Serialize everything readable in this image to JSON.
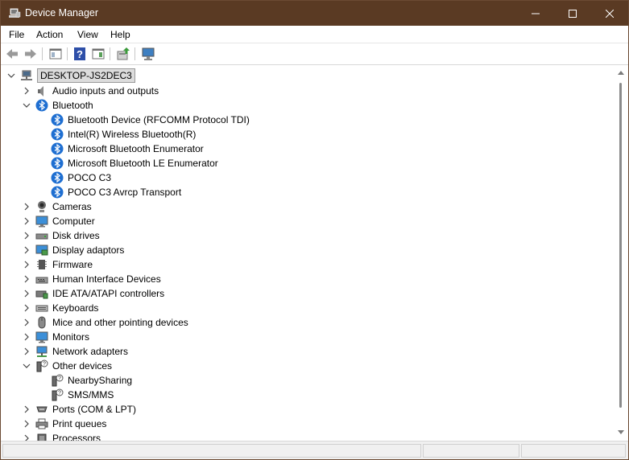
{
  "window": {
    "title": "Device Manager",
    "icons": {
      "app": "device-manager-icon",
      "minimize": "minimize-icon",
      "maximize": "maximize-icon",
      "close": "close-icon"
    },
    "colors": {
      "titlebar": "#5a3a23",
      "border": "#6b4a33",
      "root_highlight": "#dcdcdc"
    }
  },
  "menu": {
    "file": "File",
    "action": "Action",
    "view": "View",
    "help": "Help"
  },
  "toolbar": {
    "buttons": [
      {
        "name": "back-button",
        "icon": "back-arrow-icon"
      },
      {
        "name": "forward-button",
        "icon": "forward-arrow-icon"
      },
      {
        "name": "show-hide-console-tree-button",
        "icon": "console-tree-icon"
      },
      {
        "name": "help-button",
        "icon": "help-icon"
      },
      {
        "name": "action-pane-button",
        "icon": "action-pane-icon"
      },
      {
        "name": "update-driver-button",
        "icon": "update-driver-icon"
      },
      {
        "name": "scan-hardware-button",
        "icon": "scan-monitor-icon"
      }
    ]
  },
  "tree": {
    "root": {
      "label": "DESKTOP-JS2DEC3",
      "icon": "computer-network-icon",
      "expanded": true,
      "selected": true
    },
    "categories": [
      {
        "label": "Audio inputs and outputs",
        "icon": "speaker-icon",
        "expanded": false
      },
      {
        "label": "Bluetooth",
        "icon": "bluetooth-icon",
        "expanded": true,
        "children": [
          {
            "label": "Bluetooth Device (RFCOMM Protocol TDI)",
            "icon": "bluetooth-icon"
          },
          {
            "label": "Intel(R) Wireless Bluetooth(R)",
            "icon": "bluetooth-icon"
          },
          {
            "label": "Microsoft Bluetooth Enumerator",
            "icon": "bluetooth-icon"
          },
          {
            "label": "Microsoft Bluetooth LE Enumerator",
            "icon": "bluetooth-icon"
          },
          {
            "label": "POCO C3",
            "icon": "bluetooth-icon"
          },
          {
            "label": "POCO C3 Avrcp Transport",
            "icon": "bluetooth-icon"
          }
        ]
      },
      {
        "label": "Cameras",
        "icon": "camera-icon",
        "expanded": false
      },
      {
        "label": "Computer",
        "icon": "monitor-icon",
        "expanded": false
      },
      {
        "label": "Disk drives",
        "icon": "disk-drive-icon",
        "expanded": false
      },
      {
        "label": "Display adaptors",
        "icon": "display-adapter-icon",
        "expanded": false
      },
      {
        "label": "Firmware",
        "icon": "firmware-chip-icon",
        "expanded": false
      },
      {
        "label": "Human Interface Devices",
        "icon": "hid-icon",
        "expanded": false
      },
      {
        "label": "IDE ATA/ATAPI controllers",
        "icon": "ide-controller-icon",
        "expanded": false
      },
      {
        "label": "Keyboards",
        "icon": "keyboard-icon",
        "expanded": false
      },
      {
        "label": "Mice and other pointing devices",
        "icon": "mouse-icon",
        "expanded": false
      },
      {
        "label": "Monitors",
        "icon": "monitor-icon",
        "expanded": false
      },
      {
        "label": "Network adapters",
        "icon": "network-adapter-icon",
        "expanded": false
      },
      {
        "label": "Other devices",
        "icon": "unknown-device-icon",
        "expanded": true,
        "children": [
          {
            "label": "NearbySharing",
            "icon": "unknown-device-icon"
          },
          {
            "label": "SMS/MMS",
            "icon": "unknown-device-icon"
          }
        ]
      },
      {
        "label": "Ports (COM & LPT)",
        "icon": "port-icon",
        "expanded": false
      },
      {
        "label": "Print queues",
        "icon": "printer-icon",
        "expanded": false
      },
      {
        "label": "Processors",
        "icon": "processor-icon",
        "expanded": false
      }
    ]
  }
}
